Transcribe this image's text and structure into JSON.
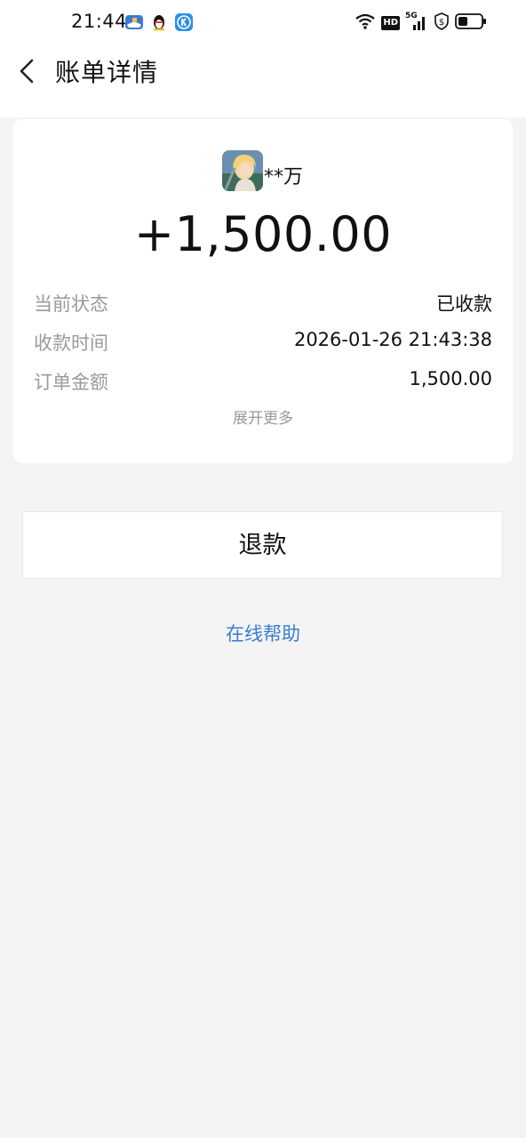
{
  "status_bar": {
    "time": "21:44",
    "notification_icons": [
      "boat-app-icon",
      "qq-penguin-icon",
      "k-app-icon"
    ],
    "system_icons": [
      "wifi-icon",
      "hd-icon",
      "signal-5g-icon",
      "shield-dollar-icon",
      "battery-icon"
    ],
    "hd_label": "HD",
    "network_label": "5G"
  },
  "header": {
    "title": "账单详情",
    "back_icon": "chevron-left-icon"
  },
  "payer": {
    "name": "**万"
  },
  "amount": "+1,500.00",
  "details": [
    {
      "label": "当前状态",
      "value": "已收款"
    },
    {
      "label": "收款时间",
      "value": "2026-01-26 21:43:38"
    },
    {
      "label": "订单金额",
      "value": "1,500.00"
    }
  ],
  "expand_label": "展开更多",
  "refund_label": "退款",
  "help_label": "在线帮助",
  "colors": {
    "background": "#f4f4f4",
    "card": "#ffffff",
    "link": "#3b7ccf",
    "muted": "#9a9a9a"
  }
}
